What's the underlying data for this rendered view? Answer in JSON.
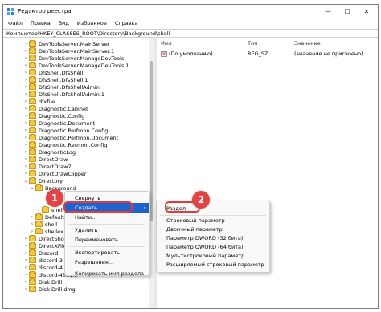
{
  "window": {
    "title": "Редактор реестра",
    "minimize_glyph": "—",
    "maximize_glyph": "☐",
    "close_glyph": "✕"
  },
  "menu": [
    "Файл",
    "Правка",
    "Вид",
    "Избранное",
    "Справка"
  ],
  "address": "Компьютер\\HKEY_CLASSES_ROOT\\Directory\\Background\\shell",
  "tree": [
    {
      "label": "DevToolsServer.MainServer",
      "expanded": false
    },
    {
      "label": "DevToolsServer.MainServer.1",
      "expanded": false
    },
    {
      "label": "DevToolsServer.ManageDevTools",
      "expanded": false
    },
    {
      "label": "DevToolsServer.ManageDevTools.1",
      "expanded": false
    },
    {
      "label": "DfsShell.DfsShell",
      "expanded": false
    },
    {
      "label": "DfsShell.DfsShell.1",
      "expanded": false
    },
    {
      "label": "DfsShell.DfsShellAdmin",
      "expanded": false
    },
    {
      "label": "DfsShell.DfsShellAdmin.1",
      "expanded": false
    },
    {
      "label": "dfxfile",
      "expanded": false
    },
    {
      "label": "Diagnostic.Cabinet",
      "expanded": false
    },
    {
      "label": "Diagnostic.Config",
      "expanded": false
    },
    {
      "label": "Diagnostic.Document",
      "expanded": false
    },
    {
      "label": "Diagnostic.Perfmon.Config",
      "expanded": false
    },
    {
      "label": "Diagnostic.Perfmon.Document",
      "expanded": false
    },
    {
      "label": "Diagnostic.Resmon.Config",
      "expanded": false
    },
    {
      "label": "DiagnosticLog",
      "expanded": false
    },
    {
      "label": "DirectDraw",
      "expanded": false
    },
    {
      "label": "DirectDraw7",
      "expanded": false
    },
    {
      "label": "DirectDrawClipper",
      "expanded": false
    },
    {
      "label": "Directory",
      "expanded": true
    },
    {
      "label": "Background",
      "expanded": true
    },
    {
      "label": "",
      "expanded": false
    },
    {
      "label": "",
      "expanded": false
    },
    {
      "label": "shell",
      "expanded": false
    },
    {
      "label": "Default",
      "expanded": false
    },
    {
      "label": "shell",
      "expanded": false
    },
    {
      "label": "shellex",
      "expanded": false
    },
    {
      "label": "DirectShow",
      "expanded": false
    },
    {
      "label": "DirectXFile",
      "expanded": false
    },
    {
      "label": "Discord",
      "expanded": false
    },
    {
      "label": "discord-3",
      "expanded": false
    },
    {
      "label": "discord-4",
      "expanded": false
    },
    {
      "label": "discord-4591...",
      "expanded": false
    },
    {
      "label": "Disk Drill",
      "expanded": false
    },
    {
      "label": "Disk Drill.dmg",
      "expanded": false
    }
  ],
  "tree_visible": {
    "discord_long": "discord-459114894446218240"
  },
  "columns": {
    "name": "Имя",
    "type": "Тип",
    "value": "Значение"
  },
  "values": [
    {
      "icon": "ab",
      "name": "(По умолчанию)",
      "type": "REG_SZ",
      "value": "(значение не присвоено)"
    }
  ],
  "context_menu": {
    "items": [
      "Свернуть",
      "Создать",
      "Найти...",
      "Удалить",
      "Переименовать",
      "Экспортировать",
      "Разрешения...",
      "Копировать имя раздела"
    ],
    "selected": "Создать"
  },
  "submenu": {
    "items": [
      "Раздел",
      "Строковый параметр",
      "Двоичный параметр",
      "Параметр DWORD (32 бита)",
      "Параметр QWORD (64 бита)",
      "Мультистроковый параметр",
      "Расширяемый строковый параметр"
    ],
    "highlighted": "Раздел"
  },
  "badges": {
    "one": "1",
    "two": "2"
  },
  "colors": {
    "accent": "#1f63d0",
    "badge": "#e24444",
    "folder": "#f3c844"
  }
}
